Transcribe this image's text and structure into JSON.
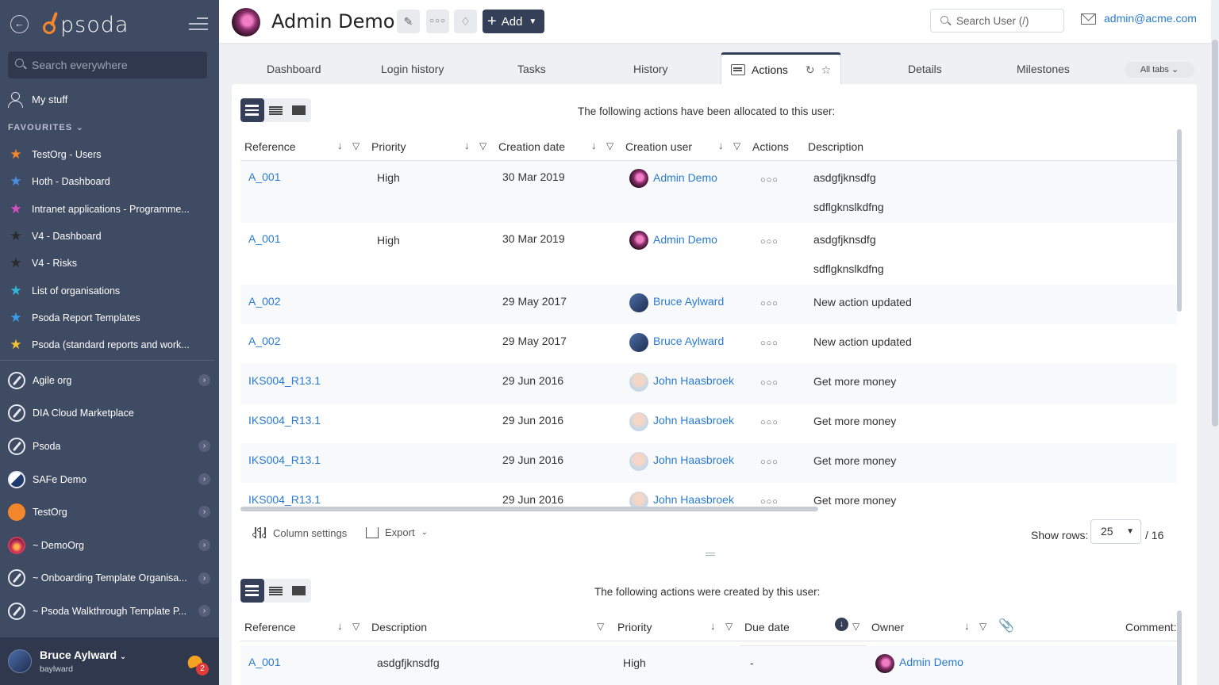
{
  "sidebar": {
    "logo_text": "psoda",
    "search_placeholder": "Search everywhere",
    "my_stuff": "My stuff",
    "favourites_heading": "FAVOURITES",
    "favourites": [
      {
        "label": "TestOrg - Users",
        "color": "#f4862b"
      },
      {
        "label": "Hoth - Dashboard",
        "color": "#4a8fe0"
      },
      {
        "label": "Intranet applications - Programme...",
        "color": "#d64fc0"
      },
      {
        "label": "V4 - Dashboard",
        "color": "#2b2b2b"
      },
      {
        "label": "V4 - Risks",
        "color": "#2b2b2b"
      },
      {
        "label": "List of organisations",
        "color": "#30b8d8"
      },
      {
        "label": "Psoda Report Templates",
        "color": "#3a9de8"
      },
      {
        "label": "Psoda (standard reports and work...",
        "color": "#f2c230"
      }
    ],
    "orgs": [
      {
        "label": "Agile org",
        "icon": "compass-icon",
        "chevron": true
      },
      {
        "label": "DIA Cloud Marketplace",
        "icon": "compass-icon",
        "chevron": false
      },
      {
        "label": "Psoda",
        "icon": "compass-icon",
        "chevron": true
      },
      {
        "label": "SAFe Demo",
        "icon": "safe-logo-icon",
        "chevron": true
      },
      {
        "label": "TestOrg",
        "icon": "orange-circle-icon",
        "chevron": true
      },
      {
        "label": "~ DemoOrg",
        "icon": "sunset-circle-icon",
        "chevron": true
      },
      {
        "label": "~ Onboarding Template Organisa...",
        "icon": "compass-icon",
        "chevron": true
      },
      {
        "label": "~ Psoda Walkthrough Template P...",
        "icon": "compass-icon",
        "chevron": true
      }
    ],
    "footer": {
      "name": "Bruce Aylward",
      "username": "baylward",
      "notifications": "2"
    }
  },
  "header": {
    "title": "Admin Demo",
    "add_label": "Add",
    "search_placeholder": "Search User (/)",
    "email": "admin@acme.com"
  },
  "tabs": {
    "items": [
      "Dashboard",
      "Login history",
      "Tasks",
      "History",
      "Actions",
      "Details",
      "Milestones"
    ],
    "active": "Actions",
    "all_tabs": "All tabs"
  },
  "allocated": {
    "caption": "The following actions have been allocated to this user:",
    "columns": [
      "Reference",
      "Priority",
      "Creation date",
      "Creation user",
      "Actions",
      "Description"
    ],
    "rows": [
      {
        "ref": "A_001",
        "priority": "High",
        "date": "30 Mar 2019",
        "user": "Admin Demo",
        "avatar": "admin",
        "desc": "asdgfjknsdfg",
        "desc2": "sdflgknslkdfng"
      },
      {
        "ref": "A_001",
        "priority": "High",
        "date": "30 Mar 2019",
        "user": "Admin Demo",
        "avatar": "admin",
        "desc": "asdgfjknsdfg",
        "desc2": "sdflgknslkdfng"
      },
      {
        "ref": "A_002",
        "priority": "",
        "date": "29 May 2017",
        "user": "Bruce Aylward",
        "avatar": "bruce",
        "desc": "New action updated",
        "desc2": ""
      },
      {
        "ref": "A_002",
        "priority": "",
        "date": "29 May 2017",
        "user": "Bruce Aylward",
        "avatar": "bruce",
        "desc": "New action updated",
        "desc2": ""
      },
      {
        "ref": "IKS004_R13.1",
        "priority": "",
        "date": "29 Jun 2016",
        "user": "John Haasbroek",
        "avatar": "john",
        "desc": "Get more money",
        "desc2": ""
      },
      {
        "ref": "IKS004_R13.1",
        "priority": "",
        "date": "29 Jun 2016",
        "user": "John Haasbroek",
        "avatar": "john",
        "desc": "Get more money",
        "desc2": ""
      },
      {
        "ref": "IKS004_R13.1",
        "priority": "",
        "date": "29 Jun 2016",
        "user": "John Haasbroek",
        "avatar": "john",
        "desc": "Get more money",
        "desc2": ""
      },
      {
        "ref": "IKS004_R13.1",
        "priority": "",
        "date": "29 Jun 2016",
        "user": "John Haasbroek",
        "avatar": "john",
        "desc": "Get more money",
        "desc2": ""
      }
    ],
    "footer": {
      "column_settings": "Column settings",
      "export": "Export",
      "show_rows_label": "Show rows:",
      "show_rows_value": "25",
      "total": "/ 16"
    }
  },
  "created": {
    "caption": "The following actions were created by this user:",
    "columns": [
      "Reference",
      "Description",
      "Priority",
      "Due date",
      "Owner",
      "Comment:"
    ],
    "rows": [
      {
        "ref": "A_001",
        "desc": "asdgfjknsdfg",
        "priority": "High",
        "due": "-",
        "owner": "Admin Demo"
      }
    ]
  }
}
